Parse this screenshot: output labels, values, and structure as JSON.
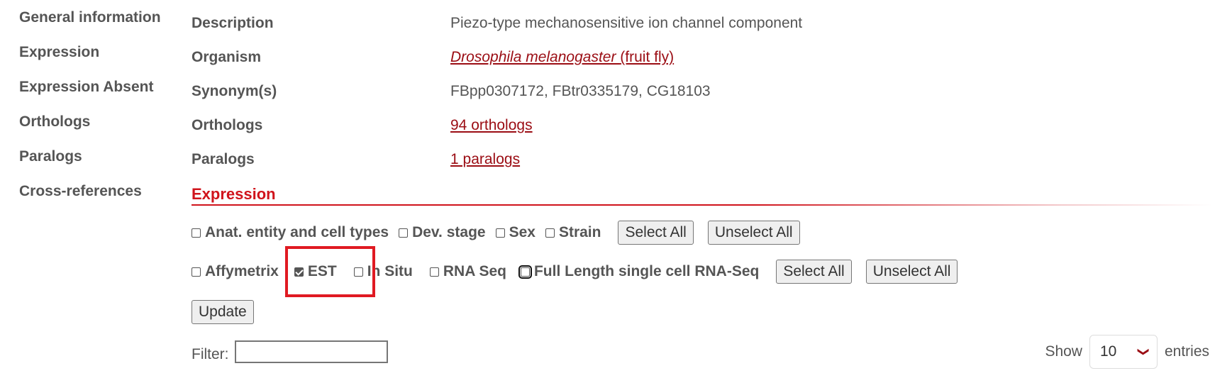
{
  "sidebar": {
    "items": [
      {
        "label": "General information"
      },
      {
        "label": "Expression"
      },
      {
        "label": "Expression Absent"
      },
      {
        "label": "Orthologs"
      },
      {
        "label": "Paralogs"
      },
      {
        "label": "Cross-references"
      }
    ]
  },
  "general": {
    "description_label": "Description",
    "description_value": "Piezo-type mechanosensitive ion channel component",
    "organism_label": "Organism",
    "organism_species": "Drosophila melanogaster ",
    "organism_common": "(fruit fly)",
    "synonyms_label": "Synonym(s)",
    "synonyms_value": "FBpp0307172, FBtr0335179, CG18103",
    "orthologs_label": "Orthologs",
    "orthologs_link": "94 orthologs",
    "paralogs_label": "Paralogs",
    "paralogs_link": "1 paralogs"
  },
  "expression": {
    "title": "Expression",
    "row1": {
      "checkboxes": [
        {
          "label": "Anat. entity and cell types",
          "checked": false
        },
        {
          "label": "Dev. stage",
          "checked": false
        },
        {
          "label": "Sex",
          "checked": false
        },
        {
          "label": "Strain",
          "checked": false
        }
      ],
      "select_all": "Select All",
      "unselect_all": "Unselect All"
    },
    "row2": {
      "checkboxes": [
        {
          "label": "Affymetrix",
          "checked": false
        },
        {
          "label": "EST",
          "checked": true
        },
        {
          "label": "In Situ",
          "checked": false
        },
        {
          "label": "RNA Seq",
          "checked": false
        },
        {
          "label": "Full Length single cell RNA-Seq",
          "checked": false
        }
      ],
      "select_all": "Select All",
      "unselect_all": "Unselect All"
    },
    "update_label": "Update",
    "filter_label": "Filter:",
    "filter_value": "",
    "show_label": "Show",
    "show_value": "10",
    "entries_label": "entries"
  },
  "colors": {
    "accent": "#d0141c",
    "link": "#9b0d14",
    "highlight_box": "#e01a22"
  }
}
